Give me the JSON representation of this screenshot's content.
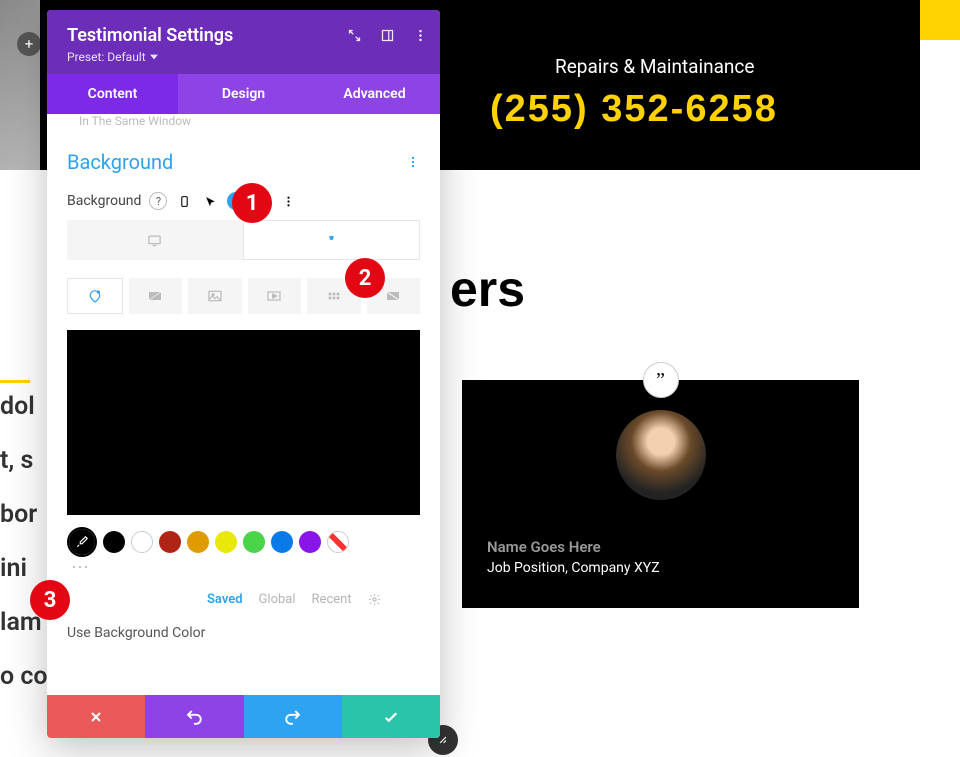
{
  "page": {
    "tagline": "Repairs & Maintainance",
    "phone": "(255) 352-6258",
    "heading_fragment": "ers",
    "left_text_lines": [
      "dol",
      "t, s",
      "bor",
      "ini",
      "lam",
      "o co"
    ],
    "testimonial": {
      "quote_glyph": "”",
      "name": "Name Goes Here",
      "job": "Job Position, Company XYZ"
    }
  },
  "panel": {
    "title": "Testimonial Settings",
    "preset": "Preset: Default",
    "tabs": {
      "content": "Content",
      "design": "Design",
      "advanced": "Advanced"
    },
    "dropdown_hint": "In The Same Window",
    "section_title": "Background",
    "field_label": "Background",
    "subtabs": {
      "saved": "Saved",
      "global": "Global",
      "recent": "Recent"
    },
    "use_color_label": "Use Background Color",
    "swatches": [
      "#000000",
      "#ffffff",
      "#b02418",
      "#e09b00",
      "#e8e80a",
      "#49d449",
      "#0a7ae8",
      "#8a15e8"
    ]
  },
  "annotations": {
    "one": "1",
    "two": "2",
    "three": "3"
  }
}
